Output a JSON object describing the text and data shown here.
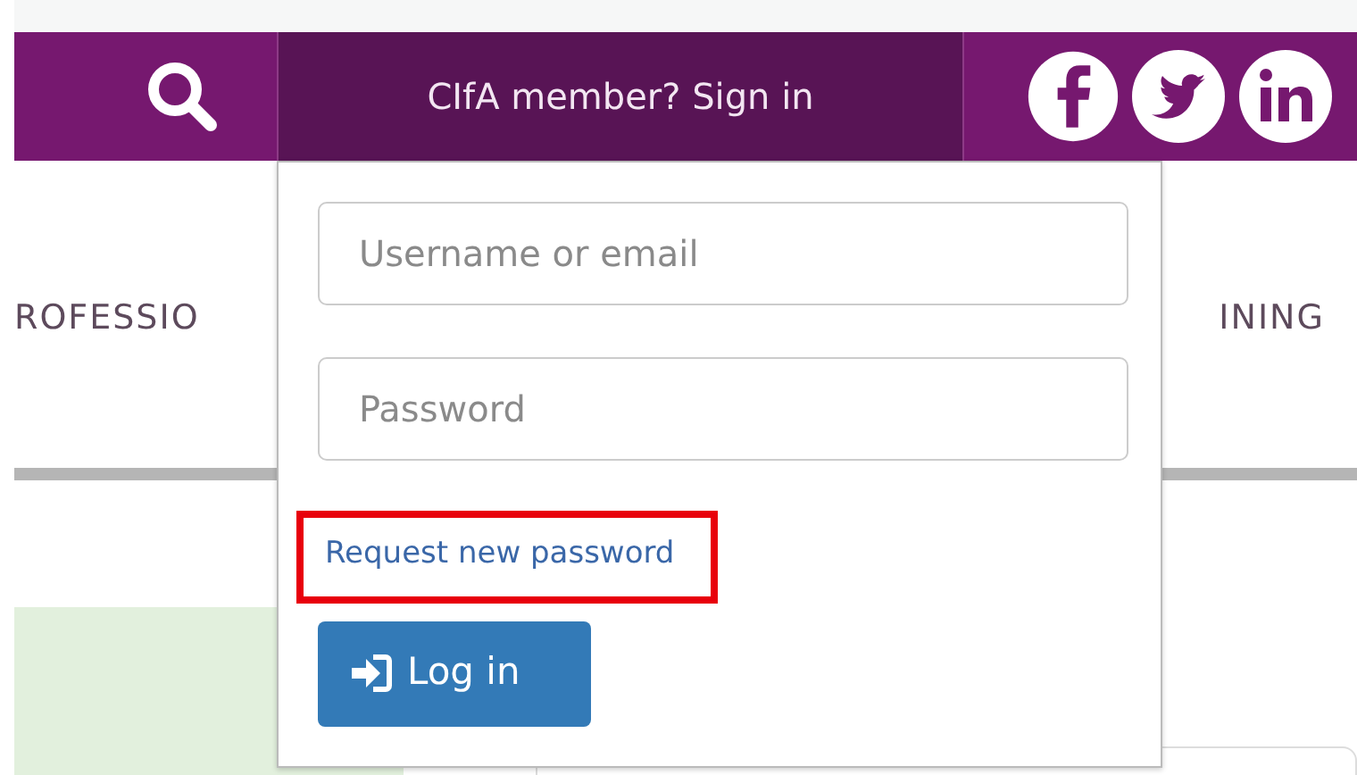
{
  "header": {
    "sign_in_label": "CIfA member? Sign in",
    "sign_in_expanded": true
  },
  "nav": {
    "items": [
      {
        "label": "ROFESSIO"
      },
      {
        "label": "INING"
      }
    ]
  },
  "login_form": {
    "username": {
      "placeholder": "Username or email"
    },
    "password": {
      "placeholder": "Password"
    },
    "reset_link": {
      "label": "Request new password",
      "highlighted": true
    },
    "submit": {
      "label": "Log in"
    }
  }
}
